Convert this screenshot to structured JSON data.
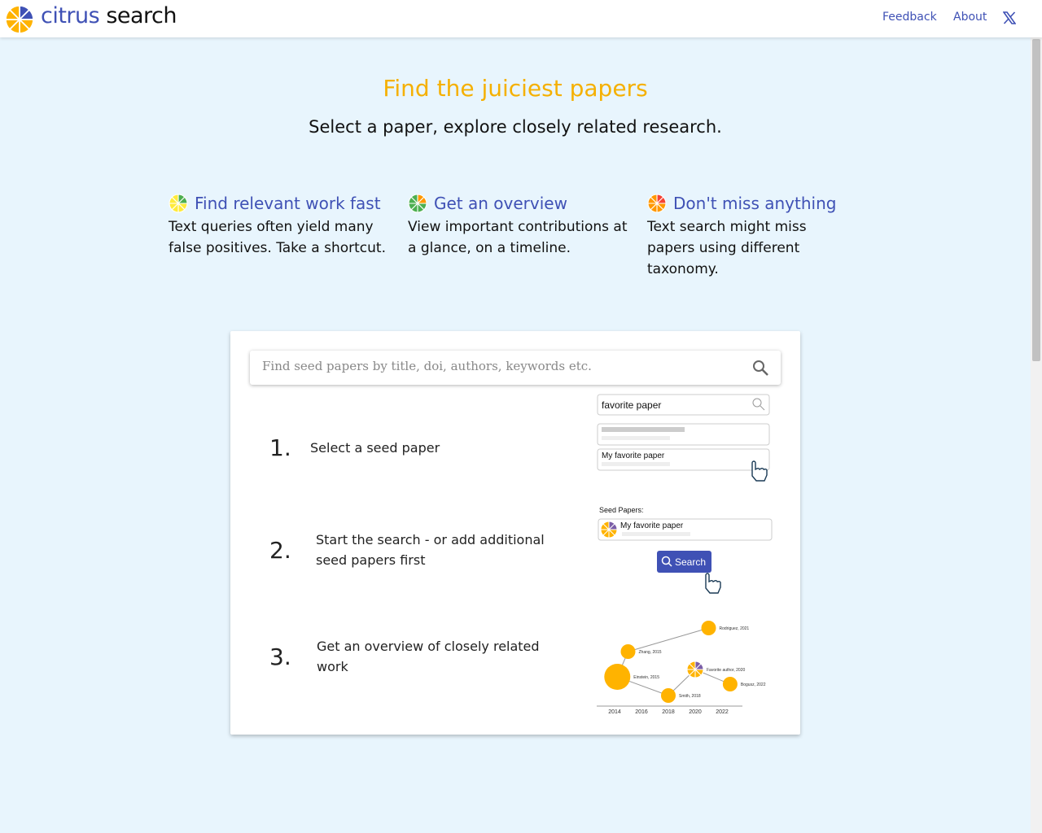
{
  "header": {
    "brand_part1": "citrus",
    "brand_part2": "search",
    "nav": [
      "Feedback",
      "About"
    ],
    "social_icon": "x-twitter-icon"
  },
  "hero": {
    "title": "Find the juiciest papers",
    "subtitle": "Select a paper, explore closely related research."
  },
  "features": [
    {
      "title": "Find relevant work fast",
      "desc": "Text queries often yield many false positives. Take a shortcut.",
      "icon_colors": [
        "#ffeb3b",
        "#4caf50"
      ]
    },
    {
      "title": "Get an overview",
      "desc": "View important contributions at a glance, on a timeline.",
      "icon_colors": [
        "#4caf50",
        "#ff9800"
      ]
    },
    {
      "title": "Don't miss anything",
      "desc": "Text search might miss papers using different taxonomy.",
      "icon_colors": [
        "#ff9800",
        "#f44336"
      ]
    }
  ],
  "search": {
    "placeholder": "Find seed papers by title, doi, authors, keywords etc."
  },
  "steps": [
    {
      "num": "1.",
      "text": "Select a seed paper"
    },
    {
      "num": "2.",
      "text": "Start the search - or add additional seed papers first"
    },
    {
      "num": "3.",
      "text": "Get an overview of closely related work"
    }
  ],
  "illustrations": {
    "step1": {
      "query": "favorite paper",
      "result": "My favorite paper"
    },
    "step2": {
      "label": "Seed Papers:",
      "paper": "My favorite paper",
      "button": "Search"
    },
    "step3": {
      "ticks": [
        "2014",
        "2016",
        "2018",
        "2020",
        "2022"
      ],
      "nodes": [
        "Rodriguez, 2021",
        "Zhang, 2015",
        "Einstein, 2015",
        "Favorite author, 2020",
        "Bogusz, 2022",
        "Smith, 2018"
      ]
    }
  },
  "colors": {
    "accent": "#3f51b5",
    "title": "#f5b000",
    "citrus": "#ffb300",
    "background": "#e8f5fd"
  }
}
